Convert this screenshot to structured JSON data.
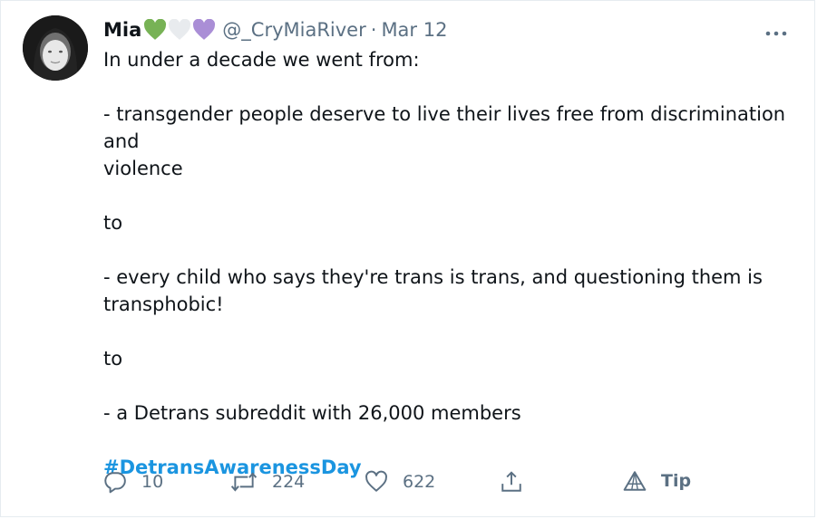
{
  "author": {
    "name": "Mia",
    "handle": "@_CryMiaRiver",
    "separator": "·",
    "date": "Mar 12",
    "badge_hearts": [
      "green-heart-icon",
      "white-heart-icon",
      "purple-heart-icon"
    ]
  },
  "tweet": {
    "line1": "In under a decade we went from:",
    "line2": "- transgender people deserve to live their lives free from discrimination and",
    "line3": "violence",
    "line4": "to",
    "line5": "- every child who says they're trans is trans, and questioning them is",
    "line6": "transphobic!",
    "line7": "to",
    "line8": "- a Detrans subreddit with 26,000 members",
    "hashtag": "#DetransAwarenessDay"
  },
  "actions": {
    "reply_count": "10",
    "retweet_count": "224",
    "like_count": "622",
    "tip_label": "Tip"
  },
  "colors": {
    "hashtag": "#1b95e0",
    "muted": "#5b7083",
    "green_heart": "#77b255",
    "purple_heart": "#aa8ed6"
  },
  "icons": {
    "more": "more-options-icon",
    "reply": "reply-icon",
    "retweet": "retweet-icon",
    "like": "heart-icon",
    "share": "share-icon",
    "tip": "tip-icon"
  }
}
